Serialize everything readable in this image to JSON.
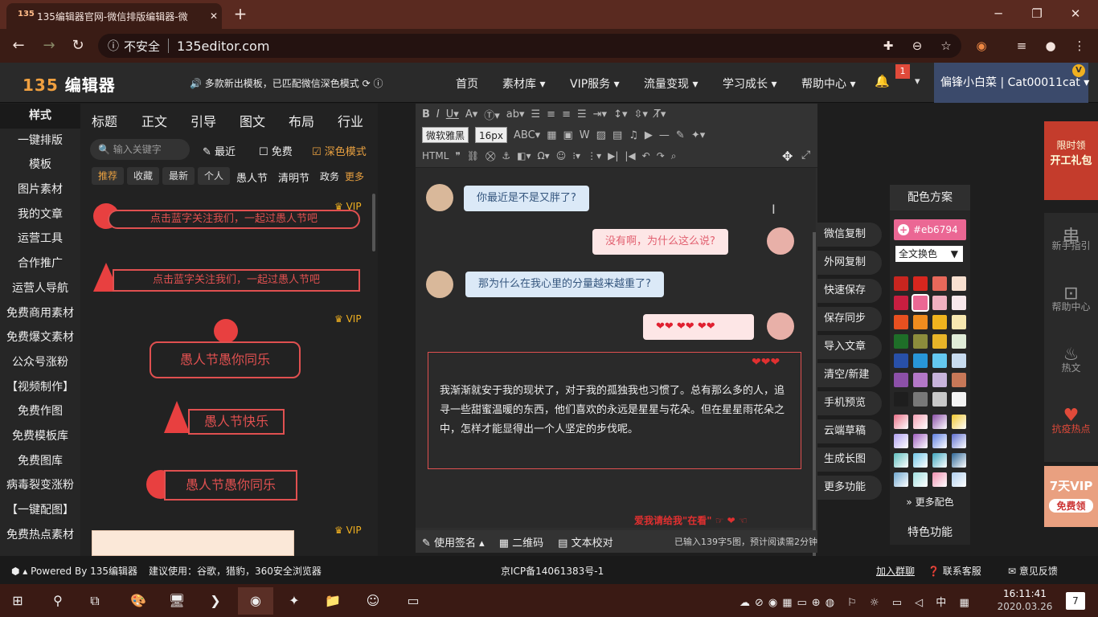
{
  "browser": {
    "tab_title": "135编辑器官网-微信排版编辑器-微",
    "new_tab": "+",
    "address_security": "不安全",
    "address_url": "135editor.com"
  },
  "site": {
    "logo": "编辑器",
    "logo_num": "135",
    "notice": "多款新出模板，已匹配微信深色模式",
    "nav": [
      "首页",
      "素材库",
      "VIP服务",
      "流量变现",
      "学习成长",
      "帮助中心"
    ],
    "badge": "1",
    "user": "偏锋小白菜 | Cat00011cat",
    "vip_badge": "V"
  },
  "left_nav": [
    "样式",
    "一键排版",
    "模板",
    "图片素材",
    "我的文章",
    "运营工具",
    "合作推广",
    "运营人导航",
    "免费商用素材",
    "免费爆文素材",
    "公众号涨粉",
    "【视频制作】",
    "免费作图",
    "免费模板库",
    "免费图库",
    "病毒裂变涨粉",
    "【一键配图】",
    "免费热点素材"
  ],
  "material": {
    "tabs": [
      "标题",
      "正文",
      "引导",
      "图文",
      "布局",
      "行业"
    ],
    "search_placeholder": "输入关键字",
    "filter_recent": "最近",
    "filter_free": "免费",
    "filter_dark": "深色模式",
    "chips": [
      "推荐",
      "收藏",
      "最新",
      "个人"
    ],
    "chips_plain": [
      "愚人节",
      "清明节",
      "政务"
    ],
    "more": "更多",
    "vip": "VIP",
    "tpl1": "点击蓝字关注我们，一起过愚人节吧",
    "tpl2": "点击蓝字关注我们，一起过愚人节吧",
    "tpl3": "愚人节愚你同乐",
    "tpl4": "愚人节快乐",
    "tpl5": "愚人节愚你同乐"
  },
  "editor": {
    "font_family": "微软雅黑",
    "font_size": "16px",
    "chat1": "你最近是不是又胖了?",
    "chat2": "没有啊，为什么这么说?",
    "chat3": "那为什么在我心里的分量越来越重了?",
    "chat4": "❤❤ ❤❤ ❤❤",
    "paragraph": "我渐渐就安于我的现状了，对于我的孤独我也习惯了。总有那么多的人，追寻一些甜蜜温暖的东西，他们喜欢的永远是星星与花朵。但在星星雨花朵之中，怎样才能显得出一个人坚定的步伐呢。",
    "footer_line": "爱我请给我\"在看\"",
    "status_signature": "使用签名",
    "status_qr": "二维码",
    "status_proof": "文本校对",
    "status_info": "已输入139字5图，预计阅读需2分钟"
  },
  "actions": [
    "微信复制",
    "外网复制",
    "快速保存",
    "保存同步",
    "导入文章",
    "清空/新建",
    "手机预览",
    "云端草稿",
    "生成长图",
    "更多功能"
  ],
  "color_panel": {
    "title": "配色方案",
    "hex": "#eb6794",
    "scope": "全文换色",
    "more": "更多配色",
    "special": "特色功能",
    "swatches": [
      "#c8251f",
      "#d8261e",
      "#e8685a",
      "#f8e0d0",
      "#c81e40",
      "#eb6794",
      "#f0b0c0",
      "#f8e8ec",
      "#e85020",
      "#f08c1e",
      "#f0b41e",
      "#f8e8b0",
      "#1e6e28",
      "#8c8c3c",
      "#e8b428",
      "#e0ecd8",
      "#2850a8",
      "#2896d8",
      "#64c8f0",
      "#c8dcf0",
      "#8c50a8",
      "#b478c8",
      "#c8b4dc",
      "#c87858",
      "#1e1e1e",
      "#787878",
      "#c8c8c8",
      "#f4f4f4"
    ],
    "gradients": [
      "#e87088",
      "#f4a0b4",
      "#8c50a8",
      "#f0c830",
      "#b0a0f0",
      "#a060c0",
      "#6080e0",
      "#6070d0",
      "#60c0c0",
      "#70c8e8",
      "#40a8c0",
      "#306898",
      "#70a8d0",
      "#a0e0e0",
      "#f090b0",
      "#b0d0f0"
    ]
  },
  "right_rail": {
    "promo_top": [
      "限时领",
      "开工礼包"
    ],
    "items": [
      "新手指引",
      "帮助中心",
      "热文",
      "抗疫热点"
    ],
    "promo_bot": [
      "7天VIP",
      "免费领"
    ]
  },
  "footer": {
    "powered": "Powered By 135编辑器",
    "suggest": "建议使用：谷歌，猎豹，360安全浏览器",
    "icp": "京ICP备14061383号-1",
    "join": "加入群聊",
    "service": "联系客服",
    "feedback": "意见反馈"
  },
  "taskbar": {
    "time": "16:11:41",
    "date": "2020.03.26",
    "notif": "7",
    "ime": "中"
  }
}
